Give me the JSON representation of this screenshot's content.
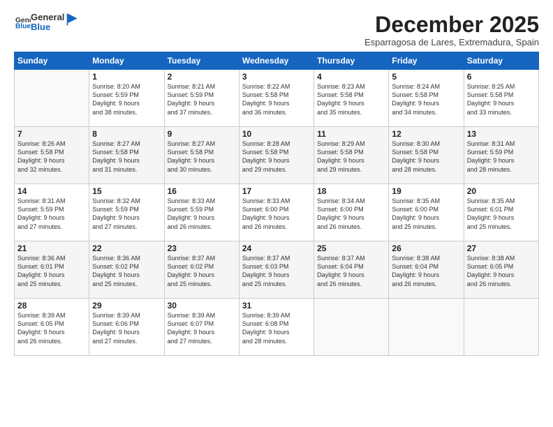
{
  "header": {
    "logo": {
      "line1": "General",
      "line2": "Blue"
    },
    "title": "December 2025",
    "location": "Esparragosa de Lares, Extremadura, Spain"
  },
  "weekdays": [
    "Sunday",
    "Monday",
    "Tuesday",
    "Wednesday",
    "Thursday",
    "Friday",
    "Saturday"
  ],
  "weeks": [
    [
      {
        "day": "",
        "info": ""
      },
      {
        "day": "1",
        "info": "Sunrise: 8:20 AM\nSunset: 5:59 PM\nDaylight: 9 hours\nand 38 minutes."
      },
      {
        "day": "2",
        "info": "Sunrise: 8:21 AM\nSunset: 5:59 PM\nDaylight: 9 hours\nand 37 minutes."
      },
      {
        "day": "3",
        "info": "Sunrise: 8:22 AM\nSunset: 5:58 PM\nDaylight: 9 hours\nand 36 minutes."
      },
      {
        "day": "4",
        "info": "Sunrise: 8:23 AM\nSunset: 5:58 PM\nDaylight: 9 hours\nand 35 minutes."
      },
      {
        "day": "5",
        "info": "Sunrise: 8:24 AM\nSunset: 5:58 PM\nDaylight: 9 hours\nand 34 minutes."
      },
      {
        "day": "6",
        "info": "Sunrise: 8:25 AM\nSunset: 5:58 PM\nDaylight: 9 hours\nand 33 minutes."
      }
    ],
    [
      {
        "day": "7",
        "info": "Sunrise: 8:26 AM\nSunset: 5:58 PM\nDaylight: 9 hours\nand 32 minutes."
      },
      {
        "day": "8",
        "info": "Sunrise: 8:27 AM\nSunset: 5:58 PM\nDaylight: 9 hours\nand 31 minutes."
      },
      {
        "day": "9",
        "info": "Sunrise: 8:27 AM\nSunset: 5:58 PM\nDaylight: 9 hours\nand 30 minutes."
      },
      {
        "day": "10",
        "info": "Sunrise: 8:28 AM\nSunset: 5:58 PM\nDaylight: 9 hours\nand 29 minutes."
      },
      {
        "day": "11",
        "info": "Sunrise: 8:29 AM\nSunset: 5:58 PM\nDaylight: 9 hours\nand 29 minutes."
      },
      {
        "day": "12",
        "info": "Sunrise: 8:30 AM\nSunset: 5:58 PM\nDaylight: 9 hours\nand 28 minutes."
      },
      {
        "day": "13",
        "info": "Sunrise: 8:31 AM\nSunset: 5:59 PM\nDaylight: 9 hours\nand 28 minutes."
      }
    ],
    [
      {
        "day": "14",
        "info": "Sunrise: 8:31 AM\nSunset: 5:59 PM\nDaylight: 9 hours\nand 27 minutes."
      },
      {
        "day": "15",
        "info": "Sunrise: 8:32 AM\nSunset: 5:59 PM\nDaylight: 9 hours\nand 27 minutes."
      },
      {
        "day": "16",
        "info": "Sunrise: 8:33 AM\nSunset: 5:59 PM\nDaylight: 9 hours\nand 26 minutes."
      },
      {
        "day": "17",
        "info": "Sunrise: 8:33 AM\nSunset: 6:00 PM\nDaylight: 9 hours\nand 26 minutes."
      },
      {
        "day": "18",
        "info": "Sunrise: 8:34 AM\nSunset: 6:00 PM\nDaylight: 9 hours\nand 26 minutes."
      },
      {
        "day": "19",
        "info": "Sunrise: 8:35 AM\nSunset: 6:00 PM\nDaylight: 9 hours\nand 25 minutes."
      },
      {
        "day": "20",
        "info": "Sunrise: 8:35 AM\nSunset: 6:01 PM\nDaylight: 9 hours\nand 25 minutes."
      }
    ],
    [
      {
        "day": "21",
        "info": "Sunrise: 8:36 AM\nSunset: 6:01 PM\nDaylight: 9 hours\nand 25 minutes."
      },
      {
        "day": "22",
        "info": "Sunrise: 8:36 AM\nSunset: 6:02 PM\nDaylight: 9 hours\nand 25 minutes."
      },
      {
        "day": "23",
        "info": "Sunrise: 8:37 AM\nSunset: 6:02 PM\nDaylight: 9 hours\nand 25 minutes."
      },
      {
        "day": "24",
        "info": "Sunrise: 8:37 AM\nSunset: 6:03 PM\nDaylight: 9 hours\nand 25 minutes."
      },
      {
        "day": "25",
        "info": "Sunrise: 8:37 AM\nSunset: 6:04 PM\nDaylight: 9 hours\nand 26 minutes."
      },
      {
        "day": "26",
        "info": "Sunrise: 8:38 AM\nSunset: 6:04 PM\nDaylight: 9 hours\nand 26 minutes."
      },
      {
        "day": "27",
        "info": "Sunrise: 8:38 AM\nSunset: 6:05 PM\nDaylight: 9 hours\nand 26 minutes."
      }
    ],
    [
      {
        "day": "28",
        "info": "Sunrise: 8:39 AM\nSunset: 6:05 PM\nDaylight: 9 hours\nand 26 minutes."
      },
      {
        "day": "29",
        "info": "Sunrise: 8:39 AM\nSunset: 6:06 PM\nDaylight: 9 hours\nand 27 minutes."
      },
      {
        "day": "30",
        "info": "Sunrise: 8:39 AM\nSunset: 6:07 PM\nDaylight: 9 hours\nand 27 minutes."
      },
      {
        "day": "31",
        "info": "Sunrise: 8:39 AM\nSunset: 6:08 PM\nDaylight: 9 hours\nand 28 minutes."
      },
      {
        "day": "",
        "info": ""
      },
      {
        "day": "",
        "info": ""
      },
      {
        "day": "",
        "info": ""
      }
    ]
  ]
}
